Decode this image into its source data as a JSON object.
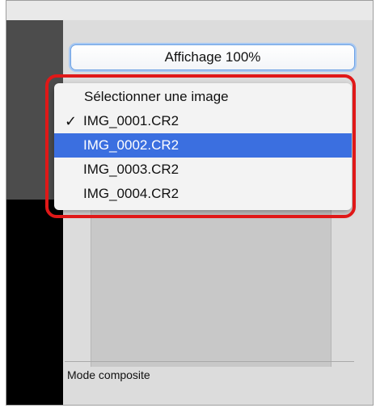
{
  "panel": {
    "view_button_label": "Affichage 100%",
    "composite_mode_label": "Mode composite"
  },
  "image_menu": {
    "header_label": "Sélectionner une image",
    "checked_item_index": 0,
    "highlighted_item_index": 1,
    "items": [
      {
        "label": "IMG_0001.CR2"
      },
      {
        "label": "IMG_0002.CR2"
      },
      {
        "label": "IMG_0003.CR2"
      },
      {
        "label": "IMG_0004.CR2"
      }
    ],
    "check_glyph": "✓"
  },
  "colors": {
    "selection_blue": "#3b6fe0",
    "callout_red": "#e01818",
    "focus_ring_blue": "#a7c8f2"
  }
}
